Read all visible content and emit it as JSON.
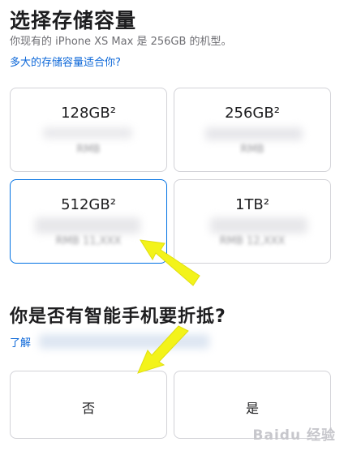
{
  "header": {
    "title": "选择存储容量",
    "subtitle": "你现有的 iPhone XS Max 是 256GB 的机型。",
    "help_link": "多大的存储容量适合你?"
  },
  "storage_options": [
    {
      "capacity": "128GB²",
      "price": "RMB"
    },
    {
      "capacity": "256GB²",
      "price": "RMB"
    },
    {
      "capacity": "512GB²",
      "price": "RMB 11,XXX"
    },
    {
      "capacity": "1TB²",
      "price": "RMB 12,XXX"
    }
  ],
  "selected_option": "512GB²",
  "trade_in": {
    "question": "你是否有智能手机要折抵?",
    "learn_more": "了解",
    "options": [
      "否",
      "是"
    ]
  },
  "watermark": "Baidu 经验",
  "colors": {
    "accent": "#0071e3",
    "link": "#0a66d8",
    "annotation_arrow": "#f3f31a"
  }
}
